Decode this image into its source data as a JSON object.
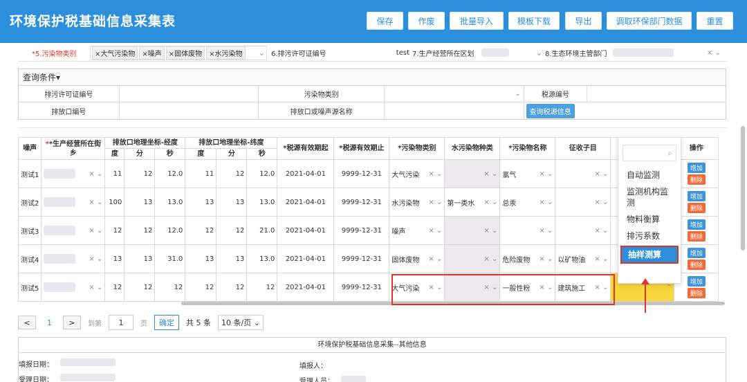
{
  "header": {
    "title": "环境保护税基础信息采集表",
    "buttons": [
      "保存",
      "作废",
      "批量导入",
      "模板下载",
      "导出",
      "调取环保部门数据",
      "重置"
    ]
  },
  "filter": {
    "pollutant_type_label": "*5.污染物类别",
    "chips": [
      "×大气污染物",
      "×噪声",
      "×固体废物",
      "×水污染物"
    ],
    "permit_label": "6.排污许可证编号",
    "permit_value": "test",
    "district_label": "7.生产经营所在区划",
    "eco_label": "8.生态环境主管部门"
  },
  "query": {
    "header": "查询条件▾",
    "permit_label": "排污许可证编号",
    "pollutant_label": "污染物类别",
    "tax_source_label": "税源编号",
    "outlet_label": "排放口编号",
    "outlet_name_label": "排放口或噪声源名称",
    "query_button": "查询税源信息"
  },
  "grid": {
    "headers": {
      "noise": "噪声",
      "street": "*生产经营所在街乡",
      "lng": "排放口地理坐标-经度",
      "lat": "排放口地理坐标-纬度",
      "deg": "度",
      "min": "分",
      "sec": "秒",
      "start": "*税源有效期起",
      "end": "*税源有效期止",
      "ptype": "*污染物类别",
      "water": "水污染物种类",
      "pname": "*污染物名称",
      "subject": "征收子目",
      "op": "操作"
    },
    "rows": [
      {
        "noise": "测试1",
        "lng_d": "11",
        "lng_m": "12",
        "lng_s": "12.0",
        "lat_d": "11",
        "lat_m": "12",
        "lat_s": "12.0",
        "start": "2021-04-01",
        "end": "9999-12-31",
        "ptype": "大气污染",
        "water": "",
        "pname": "氯气",
        "subject": ""
      },
      {
        "noise": "测试2",
        "lng_d": "100",
        "lng_m": "13",
        "lng_s": "13.0",
        "lat_d": "13",
        "lat_m": "13",
        "lat_s": "13.0",
        "start": "2021-04-01",
        "end": "9999-12-31",
        "ptype": "水污染物",
        "water": "第一类水",
        "pname": "总汞",
        "subject": ""
      },
      {
        "noise": "测试3",
        "lng_d": "12",
        "lng_m": "12",
        "lng_s": "12.0",
        "lat_d": "12",
        "lat_m": "12",
        "lat_s": "21.0",
        "start": "2021-04-01",
        "end": "9999-12-31",
        "ptype": "噪声",
        "water": "",
        "pname": "",
        "subject": ""
      },
      {
        "noise": "测试4",
        "lng_d": "13",
        "lng_m": "13",
        "lng_s": "31.0",
        "lat_d": "13",
        "lat_m": "13",
        "lat_s": "13.0",
        "start": "2021-04-01",
        "end": "9999-12-31",
        "ptype": "固体废物",
        "water": "",
        "pname": "危险废物",
        "subject": "以矿物油"
      },
      {
        "noise": "测试5",
        "lng_d": "12",
        "lng_m": "12",
        "lng_s": "12",
        "lat_d": "12",
        "lat_m": "12",
        "lat_s": "12",
        "start": "2021-04-01",
        "end": "9999-12-31",
        "ptype": "大气污染",
        "water": "",
        "pname": "一般性粉",
        "subject": "建筑施工"
      }
    ],
    "add_label": "增加",
    "del_label": "删除",
    "clear_glyph": "×",
    "chevron_glyph": "⌄"
  },
  "dropdown": {
    "options": [
      "自动监测",
      "监测机构监测",
      "物料衡算",
      "排污系数",
      "抽样测算"
    ],
    "selected": "抽样测算"
  },
  "pager": {
    "prev": "<",
    "current": "1",
    "next": ">",
    "goto_label": "到第",
    "goto_value": "1",
    "page_label": "页",
    "confirm": "确定",
    "total": "共 5 条",
    "size": "10 条/页 ⌄"
  },
  "other": {
    "title": "环境保护税基础信息采集--其他信息",
    "fill_date_label": "填报日期：",
    "filler_label": "填报人：",
    "accept_date_label": "受理日期：",
    "acceptor_label": "受理人员："
  },
  "colors": {
    "header_bg": "#2b8fdc",
    "highlight": "#e0332b",
    "add": "#3e93dc",
    "delete": "#f06a3a"
  }
}
